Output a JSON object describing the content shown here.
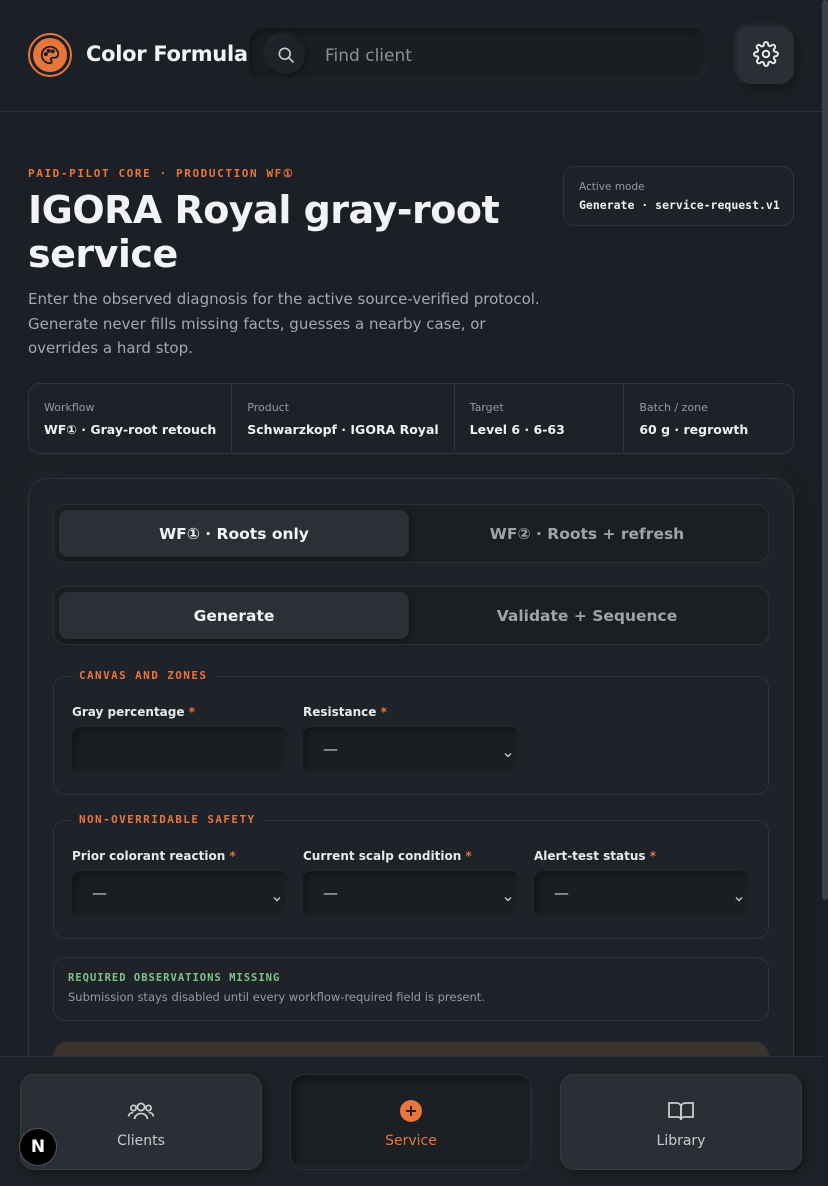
{
  "header": {
    "app_title": "Color Formula",
    "search_placeholder": "Find client",
    "search_value": ""
  },
  "intro": {
    "eyebrow": "PAID-PILOT CORE · PRODUCTION WF①",
    "title": "IGORA Royal gray-root service",
    "description": "Enter the observed diagnosis for the active source-verified protocol. Generate never fills missing facts, guesses a nearby case, or overrides a hard stop."
  },
  "mode": {
    "label": "Active mode",
    "value": "Generate · service-request.v1"
  },
  "summary": [
    {
      "label": "Workflow",
      "value": "WF① · Gray-root retouch"
    },
    {
      "label": "Product",
      "value": "Schwarzkopf · IGORA Royal"
    },
    {
      "label": "Target",
      "value": "Level 6 · 6-63"
    },
    {
      "label": "Batch / zone",
      "value": "60 g · regrowth"
    }
  ],
  "workflow_toggle": {
    "options": [
      "WF① · Roots only",
      "WF② · Roots + refresh"
    ],
    "selected": "WF① · Roots only"
  },
  "mode_toggle": {
    "options": [
      "Generate",
      "Validate + Sequence"
    ],
    "selected": "Generate"
  },
  "canvas": {
    "legend": "CANVAS AND ZONES",
    "gray_label": "Gray percentage",
    "gray_value": "",
    "resistance_label": "Resistance",
    "resistance_value": "—"
  },
  "safety": {
    "legend": "NON-OVERRIDABLE SAFETY",
    "prior_label": "Prior colorant reaction",
    "prior_value": "—",
    "scalp_label": "Current scalp condition",
    "scalp_value": "—",
    "alert_label": "Alert-test status",
    "alert_value": "—"
  },
  "required_marker": "*",
  "notice": {
    "title": "REQUIRED OBSERVATIONS MISSING",
    "text": "Submission stays disabled until every workflow-required field is present."
  },
  "bottom_nav": [
    {
      "label": "Clients",
      "icon": "users-icon"
    },
    {
      "label": "Service",
      "icon": "plus-circle-icon",
      "active": true
    },
    {
      "label": "Library",
      "icon": "book-icon"
    }
  ],
  "badge": "N",
  "colors": {
    "accent": "#e8763a",
    "success": "#7fc489",
    "background": "#1c1f25"
  }
}
